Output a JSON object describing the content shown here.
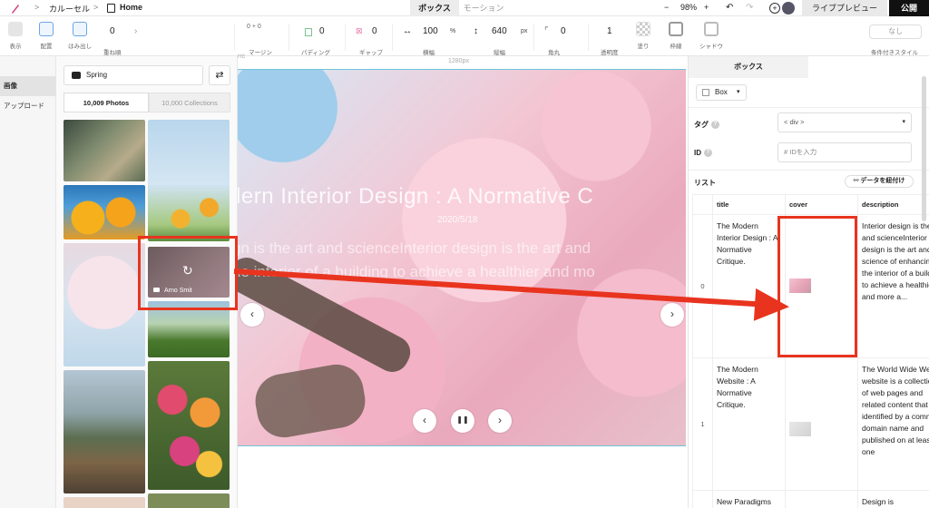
{
  "topbar": {
    "breadcrumb_1": "カルーセル",
    "breadcrumb_2": "Home",
    "sep": ">",
    "tab_box": "ボックス",
    "tab_motion": "モーション",
    "zoom": "98%",
    "zoom_minus": "−",
    "zoom_plus": "+",
    "live_preview": "ライブプレビュー",
    "publish": "公開"
  },
  "toolbar": {
    "display": "表示",
    "layout": "配置",
    "overflow": "はみ出し",
    "stack_value": "0",
    "stack": "重ね順",
    "margin": "マージン",
    "margin_value": "0",
    "padding_value": "0",
    "padding": "パディング",
    "gap_value": "0",
    "gap": "ギャップ",
    "width_value": "100",
    "width_unit": "%",
    "width": "横幅",
    "height_value": "640",
    "height_unit": "px",
    "height": "縦幅",
    "radius_value": "0",
    "radius": "角丸",
    "opacity_value": "1",
    "opacity": "透明度",
    "fill": "塗り",
    "border": "枠線",
    "shadow": "シャドウ",
    "cond_button": "なし",
    "cond_label": "条件付きスタイル"
  },
  "leftnav": {
    "images": "画像",
    "upload": "アップロード"
  },
  "photos": {
    "search_value": "Spring",
    "tab_photos": "10,009 Photos",
    "tab_collections": "10,000 Collections",
    "overlay_author": "Arno Smit",
    "shuffle": "⇄",
    "reload": "↻"
  },
  "canvas": {
    "ruler_label": "1280px",
    "ruler_left": "rrc",
    "title": "dern Interior Design : A Normative C",
    "date": "2020/5/18",
    "desc_line1": "gn is the art and scienceInterior design is the art and",
    "desc_line2": "he interior of a building to achieve a healthier and mo",
    "prev": "‹",
    "next": "›",
    "ctl_prev": "‹",
    "ctl_pause": "❚❚",
    "ctl_next": "›"
  },
  "inspector": {
    "tab": "ボックス",
    "box_select": "Box",
    "tag_label": "タグ",
    "tag_value": "< div >",
    "id_label": "ID",
    "id_placeholder": "# IDを入力",
    "list_label": "リスト",
    "bind_button": "データを紐付け",
    "help": "?",
    "columns": [
      "title",
      "cover",
      "description"
    ],
    "rows": [
      {
        "index": "0",
        "title": "The Modern Interior Design : A Normative Critique.",
        "description": "Interior design is the art and scienceInterior design is the art and science of enhancing the interior of a building to achieve a healthier and more a..."
      },
      {
        "index": "1",
        "title": "The Modern Website : A Normative Critique.",
        "description": "The World Wide Web A website is a collection of web pages and related content that is identified by a common domain name and published on at least one"
      },
      {
        "index": "",
        "title": "New Paradigms",
        "description": "Design is"
      }
    ]
  },
  "colors": {
    "accent_red": "#e8341f",
    "publish_bg": "#111111",
    "selection_cyan": "#6ec5d9"
  }
}
